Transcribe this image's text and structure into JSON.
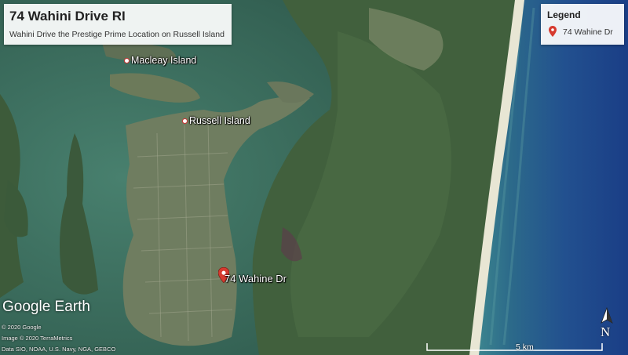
{
  "title_panel": {
    "title": "74 Wahini Drive RI",
    "subtitle": "Wahini Drive the Prestige Prime Location on Russell Island"
  },
  "legend": {
    "title": "Legend",
    "entries": [
      {
        "label": "74 Wahine Dr",
        "icon": "red-pin-icon"
      }
    ]
  },
  "places": [
    {
      "name": "Macleay Island"
    },
    {
      "name": "Russell Island"
    }
  ],
  "marker": {
    "label": "74 Wahine Dr",
    "color": "#d63a2f"
  },
  "brand": "Google Earth",
  "credits": [
    "© 2020 Google",
    "Image © 2020 TerraMetrics",
    "Data SIO, NOAA, U.S. Navy, NGA, GEBCO"
  ],
  "compass": {
    "letter": "N"
  },
  "scale": {
    "label": "5 km"
  },
  "colors": {
    "ocean_deep": "#1b3f86",
    "ocean_surf": "#3d7f8c",
    "bay_water": "#36675c",
    "land_green": "#3a5a3c",
    "beach": "#e8e6d4",
    "pin_red": "#d63a2f"
  }
}
